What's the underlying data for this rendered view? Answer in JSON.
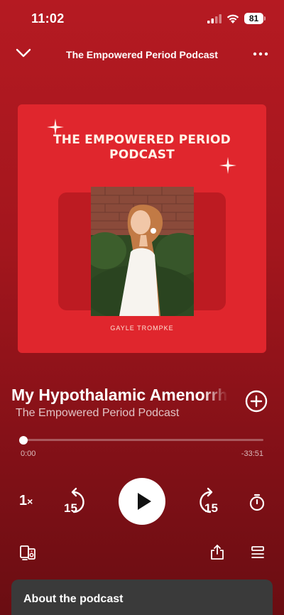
{
  "status_bar": {
    "time": "11:02",
    "battery": "81"
  },
  "header": {
    "title": "The Empowered Period Podcast"
  },
  "artwork": {
    "title_line1": "THE EMPOWERED PERIOD",
    "title_line2": "PODCAST",
    "author": "GAYLE TROMPKE",
    "background_color": "#e0262d"
  },
  "episode": {
    "title": "My Hypothalamic Amenorrhea",
    "show": "The Empowered Period Podcast"
  },
  "progress": {
    "elapsed": "0:00",
    "remaining": "-33:51",
    "fraction": 0.0
  },
  "controls": {
    "speed": "1",
    "speed_suffix": "×",
    "skip_back_seconds": "15",
    "skip_forward_seconds": "15"
  },
  "about": {
    "title": "About the podcast"
  },
  "icons": {
    "collapse": "chevron-down-icon",
    "more": "more-icon",
    "add": "add-circle-icon",
    "play": "play-icon",
    "timer": "sleep-timer-icon",
    "device": "connect-device-icon",
    "share": "share-icon",
    "queue": "queue-icon"
  }
}
